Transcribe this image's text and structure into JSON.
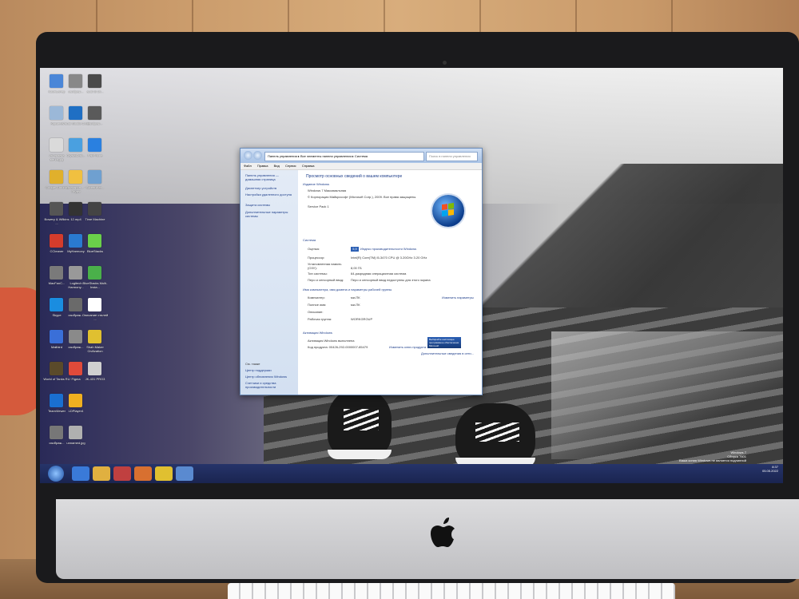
{
  "window": {
    "address": "Панель управления ▸ Все элементы панели управления ▸ Система",
    "search_placeholder": "Поиск в панели управления",
    "menu": [
      "Файл",
      "Правка",
      "Вид",
      "Сервис",
      "Справка"
    ],
    "left_pane": {
      "home": "Панель управления — домашняя страница",
      "links": [
        "Диспетчер устройств",
        "Настройка удаленного доступа",
        "Защита системы",
        "Дополнительные параметры системы"
      ],
      "see_also_title": "См. также",
      "see_also": [
        "Центр поддержки",
        "Центр обновления Windows",
        "Счетчики и средства производительности"
      ]
    },
    "main": {
      "heading": "Просмотр основных сведений о вашем компьютере",
      "edition_title": "Издание Windows",
      "edition": "Windows 7 Максимальная",
      "copyright": "© Корпорация Майкрософт (Microsoft Corp.), 2009. Все права защищены.",
      "service_pack": "Service Pack 1",
      "system_title": "Система",
      "rows": [
        {
          "k": "Оценка:",
          "v": "Индекс производительности Windows",
          "rating": "5,9"
        },
        {
          "k": "Процессор:",
          "v": "Intel(R) Core(TM) i5-3470 CPU @ 3.20GHz  3.20 GHz"
        },
        {
          "k": "Установленная память (ОЗУ):",
          "v": "8,00 ГБ"
        },
        {
          "k": "Тип системы:",
          "v": "64-разрядная операционная система"
        },
        {
          "k": "Перо и сенсорный ввод:",
          "v": "Перо и сенсорный ввод недоступны для этого экрана"
        }
      ],
      "computer_title": "Имя компьютера, имя домена и параметры рабочей группы",
      "computer_rows": [
        {
          "k": "Компьютер:",
          "v": "ми-ПК"
        },
        {
          "k": "Полное имя:",
          "v": "ми-ПК"
        },
        {
          "k": "Описание:",
          "v": ""
        },
        {
          "k": "Рабочая группа:",
          "v": "WORKGROUP"
        }
      ],
      "change_settings": "Изменить параметры",
      "activation_title": "Активация Windows",
      "activation_status": "Активация Windows выполнена",
      "product_code": "Код продукта: 00426-292-0000007-85479",
      "change_key": "Изменить ключ продукта",
      "genuine_badge": "Выбирайте настоящее программное обеспечение Microsoft",
      "more_online": "Дополнительные сведения в сети..."
    }
  },
  "taskbar": {
    "time": "8:37",
    "date": "05.05.2022",
    "watermark_lines": [
      "Windows 7",
      "Сборка 7601",
      "Ваша копия Windows не является подлинной"
    ]
  },
  "desktop_icons": [
    {
      "label": "Компьютер",
      "color": "#4a86d8"
    },
    {
      "label": "Корзина",
      "color": "#9bb8d8"
    },
    {
      "label": "vst правка ветка.jpg",
      "color": "#dadada"
    },
    {
      "label": "Google Chrome",
      "color": "#e0b02c"
    },
    {
      "label": "Bowery & Wilkins ...",
      "color": "#555555"
    },
    {
      "label": "CCleaner",
      "color": "#d43c2c"
    },
    {
      "label": "MacFanC...",
      "color": "#7a7a7a"
    },
    {
      "label": "Skype",
      "color": "#1a8de0"
    },
    {
      "label": "Mailbird",
      "color": "#3a6fd8"
    },
    {
      "label": "World of Tanks RU",
      "color": "#5a4a2a"
    },
    {
      "label": "TeamViewer",
      "color": "#1a6fd0"
    },
    {
      "label": "изображ...",
      "color": "#777777"
    },
    {
      "label": "изображ...",
      "color": "#888888"
    },
    {
      "label": "Visual Studio Code",
      "color": "#1f6fc4"
    },
    {
      "label": "CrystalDisk...",
      "color": "#4aa0e0"
    },
    {
      "label": "Электрон... - Яндек",
      "color": "#f0c040"
    },
    {
      "label": "12.mp4",
      "color": "#333333"
    },
    {
      "label": "MyHarmony",
      "color": "#2a7ad0"
    },
    {
      "label": "Logitech Harmony...",
      "color": "#999999"
    },
    {
      "label": "изображ...",
      "color": "#6a6a6a"
    },
    {
      "label": "изображ...",
      "color": "#8a8a8a"
    },
    {
      "label": "Figma",
      "color": "#e04a3a"
    },
    {
      "label": "LDPlayer4",
      "color": "#f0b020"
    },
    {
      "label": "unnamed.jpg",
      "color": "#b0b0b0"
    },
    {
      "label": "audi-id-19...",
      "color": "#4a4a4a"
    },
    {
      "label": "изображ...",
      "color": "#5a5a5a"
    },
    {
      "label": "PairPhone",
      "color": "#2a80e0"
    },
    {
      "label": "ScreenHer...",
      "color": "#6fa0d0"
    },
    {
      "label": "Time Machine",
      "color": "#444444"
    },
    {
      "label": "BlueStacks",
      "color": "#6ad04a"
    },
    {
      "label": "BlueStacks Multi-Insta...",
      "color": "#4ab04a"
    },
    {
      "label": "Описание стилей ...",
      "color": "#ffffff"
    },
    {
      "label": "Shah Maker Civilization",
      "color": "#e0c030"
    },
    {
      "label": "JK-431 PRO3",
      "color": "#d0d0d0"
    }
  ]
}
